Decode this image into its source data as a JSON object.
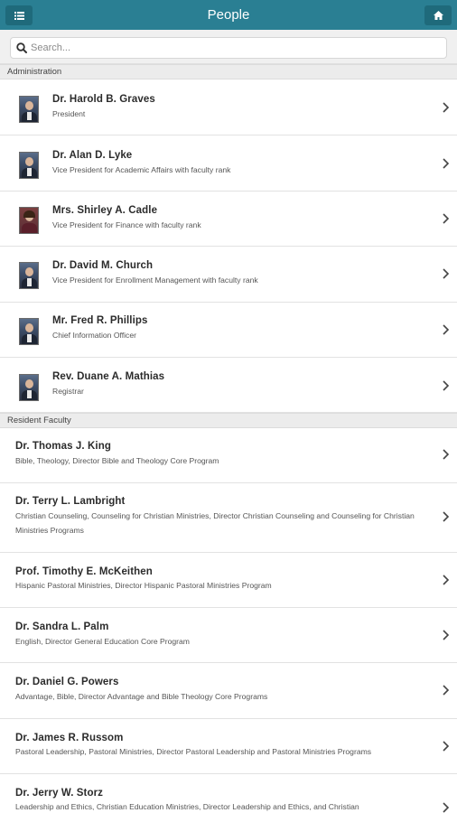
{
  "header": {
    "title": "People",
    "menu_icon": "list-icon",
    "home_icon": "home-icon",
    "color": "#2a7f93"
  },
  "search": {
    "placeholder": "Search...",
    "value": ""
  },
  "sections": [
    {
      "label": "Administration",
      "people": [
        {
          "name": "Dr. Harold B. Graves",
          "title": "President",
          "photo": "male"
        },
        {
          "name": "Dr. Alan D. Lyke",
          "title": "Vice President for Academic Affairs with faculty rank",
          "photo": "male"
        },
        {
          "name": "Mrs. Shirley A. Cadle",
          "title": "Vice President for Finance with faculty rank",
          "photo": "female"
        },
        {
          "name": "Dr. David M. Church",
          "title": "Vice President for Enrollment Management with faculty rank",
          "photo": "male"
        },
        {
          "name": "Mr. Fred R. Phillips",
          "title": "Chief Information Officer",
          "photo": "male"
        },
        {
          "name": "Rev. Duane A. Mathias",
          "title": "Registrar",
          "photo": "male"
        }
      ]
    },
    {
      "label": "Resident Faculty",
      "people": [
        {
          "name": "Dr. Thomas J. King",
          "title": "Bible, Theology, Director Bible and Theology Core Program"
        },
        {
          "name": "Dr. Terry L. Lambright",
          "title": "Christian Counseling, Counseling for Christian Ministries, Director Christian Counseling and Counseling for Christian Ministries Programs"
        },
        {
          "name": "Prof. Timothy E. McKeithen",
          "title": "Hispanic Pastoral Ministries, Director Hispanic Pastoral Ministries Program"
        },
        {
          "name": "Dr. Sandra L. Palm",
          "title": "English, Director General Education Core Program"
        },
        {
          "name": "Dr. Daniel G. Powers",
          "title": "Advantage, Bible, Director Advantage and Bible Theology Core Programs"
        },
        {
          "name": "Dr. James R. Russom",
          "title": "Pastoral Leadership, Pastoral Ministries, Director Pastoral Leadership and Pastoral Ministries Programs"
        },
        {
          "name": "Dr. Jerry W. Storz",
          "title": "Leadership and Ethics, Christian Education Ministries, Director Leadership and Ethics, and Christian"
        }
      ]
    }
  ]
}
